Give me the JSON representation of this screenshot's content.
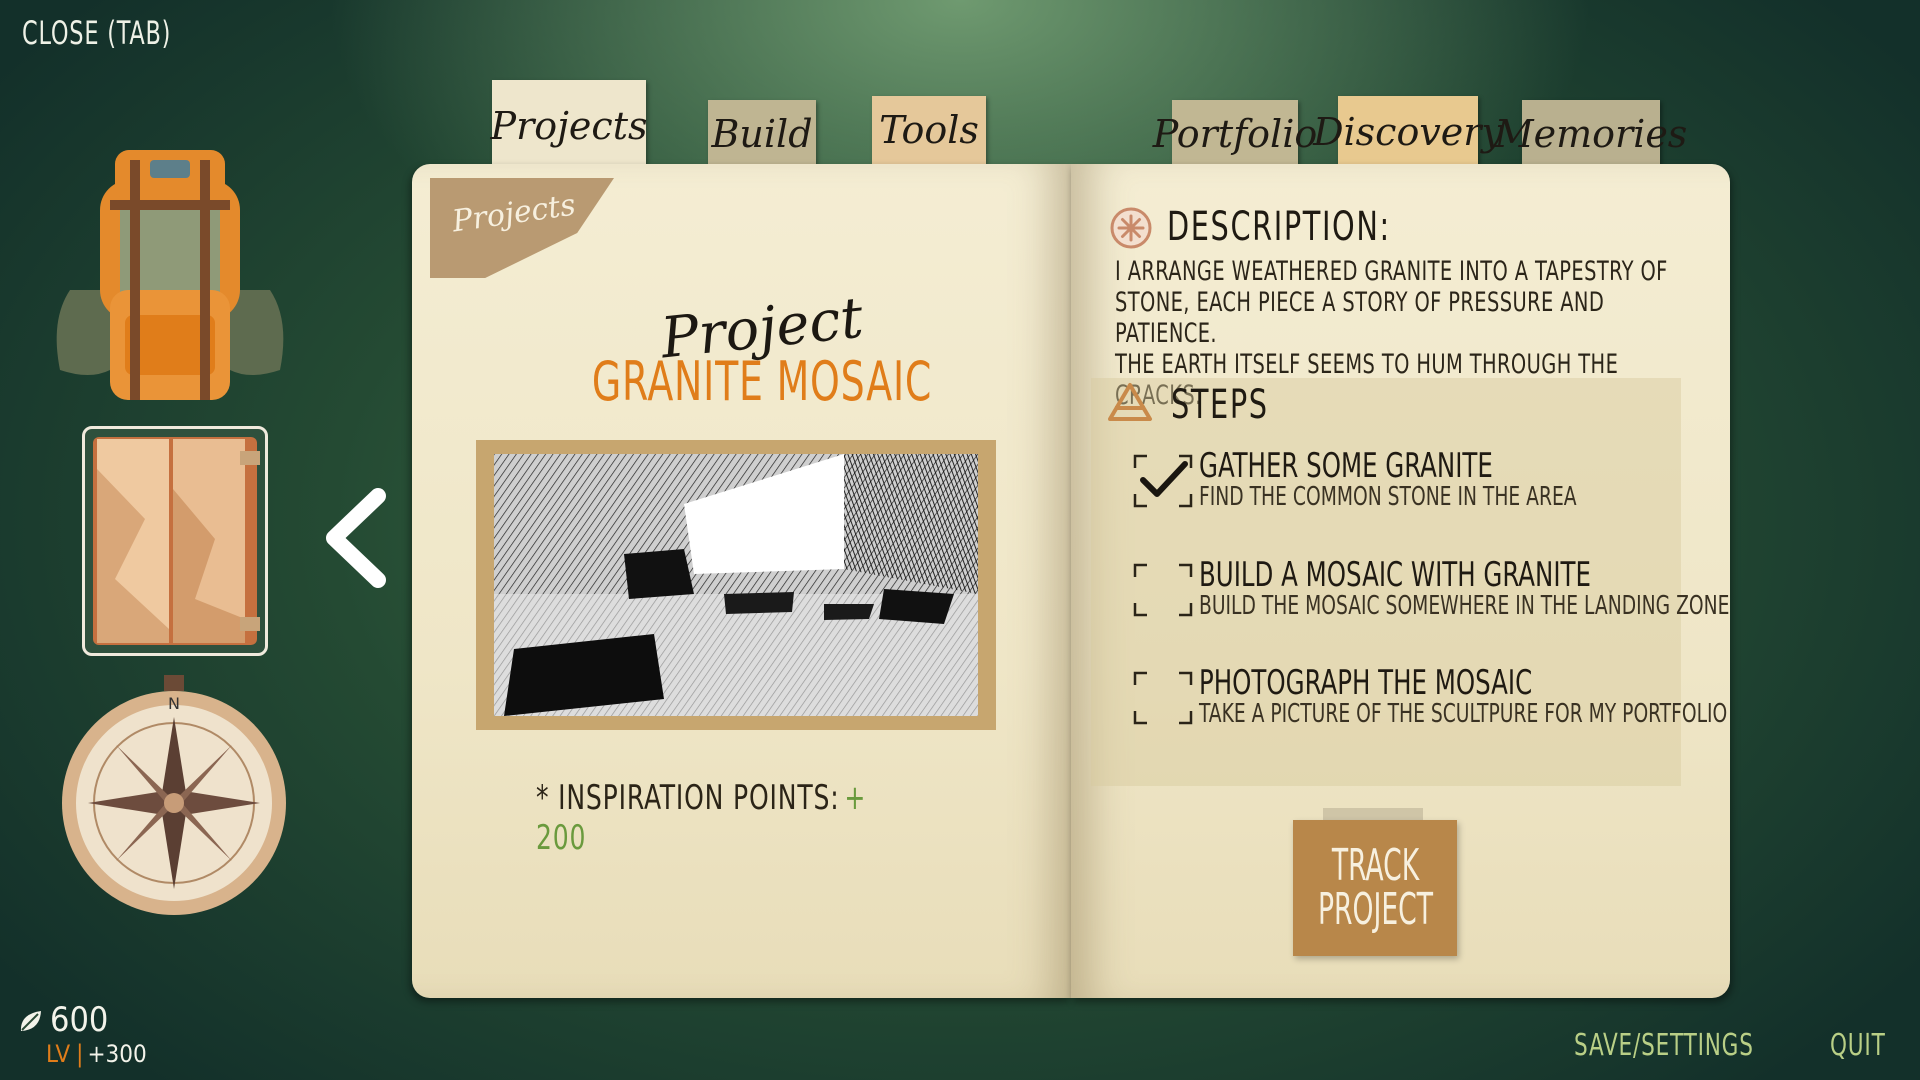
{
  "top": {
    "close_label": "CLOSE (TAB)"
  },
  "tabs": [
    {
      "label": "Projects",
      "active": true
    },
    {
      "label": "Build"
    },
    {
      "label": "Tools"
    },
    {
      "label": "Portfolio"
    },
    {
      "label": "Discovery"
    },
    {
      "label": "Memories"
    }
  ],
  "sidebar": {
    "items": [
      {
        "icon": "backpack-icon"
      },
      {
        "icon": "journal-icon",
        "selected": true
      },
      {
        "icon": "compass-icon"
      }
    ]
  },
  "player": {
    "currency": "600",
    "level_label": "LV",
    "level_sep": "|",
    "xp_gain": "+300"
  },
  "left_page": {
    "corner_label": "Projects",
    "script_label": "Project",
    "title": "GRANITE MOSAIC",
    "inspiration_label": "* INSPIRATION POINTS:",
    "inspiration_value": "+ 200"
  },
  "right_page": {
    "description_heading": "DESCRIPTION:",
    "description_lines": [
      "I ARRANGE WEATHERED GRANITE INTO A TAPESTRY OF",
      "STONE, EACH PIECE A STORY OF PRESSURE AND PATIENCE.",
      "THE EARTH ITSELF SEEMS TO HUM THROUGH THE CRACKS."
    ],
    "steps_heading": "STEPS",
    "steps": [
      {
        "title": "GATHER SOME GRANITE",
        "subtitle": "FIND THE COMMON STONE IN THE AREA",
        "done": true
      },
      {
        "title": "BUILD A MOSAIC WITH GRANITE",
        "subtitle": "BUILD THE MOSAIC SOMEWHERE IN THE LANDING ZONE",
        "done": false
      },
      {
        "title": "PHOTOGRAPH THE MOSAIC",
        "subtitle": "TAKE A PICTURE OF THE SCULTPURE FOR MY PORTFOLIO",
        "done": false
      }
    ],
    "track_label": [
      "TRACK",
      "PROJECT"
    ]
  },
  "footer": {
    "save_settings": "SAVE/SETTINGS",
    "quit": "QUIT"
  },
  "colors": {
    "accent_orange": "#e07d1a",
    "accent_green": "#6a9a3d",
    "footer_text": "#b9cf86",
    "paper": "#f4edd3"
  }
}
